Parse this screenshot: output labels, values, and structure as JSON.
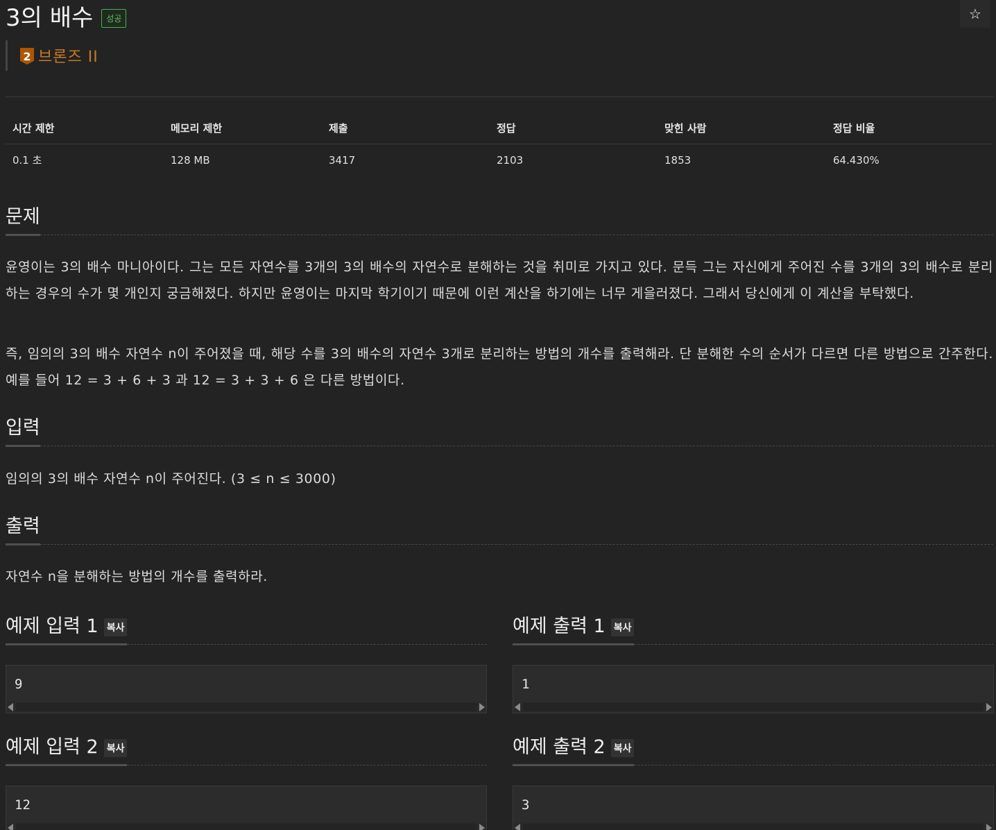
{
  "problem": {
    "title": "3의 배수",
    "result_badge": "성공",
    "star_icon": "☆",
    "tier": {
      "number": "2",
      "label": "브론즈 II",
      "color": "#ad5600"
    }
  },
  "info_table": {
    "headers": [
      "시간 제한",
      "메모리 제한",
      "제출",
      "정답",
      "맞힌 사람",
      "정답 비율"
    ],
    "values": [
      "0.1 초",
      "128 MB",
      "3417",
      "2103",
      "1853",
      "64.430%"
    ]
  },
  "sections": {
    "description": {
      "title": "문제",
      "paragraphs": [
        "윤영이는 3의 배수 마니아이다. 그는 모든 자연수를 3개의 3의 배수의 자연수로 분해하는 것을 취미로 가지고 있다. 문득 그는 자신에게 주어진 수를 3개의 3의 배수로 분리하는 경우의 수가 몇 개인지 궁금해졌다. 하지만 윤영이는 마지막 학기이기 때문에 이런 계산을 하기에는 너무 게을러졌다. 그래서 당신에게 이 계산을 부탁했다.",
        "즉, 임의의 3의 배수 자연수 n이 주어졌을 때, 해당 수를 3의 배수의 자연수 3개로 분리하는 방법의 개수를 출력해라. 단 분해한 수의 순서가 다르면 다른 방법으로 간주한다. 예를 들어 12 = 3 + 6 + 3 과 12 = 3 + 3 + 6 은 다른 방법이다."
      ]
    },
    "input": {
      "title": "입력",
      "text": "임의의 3의 배수 자연수 n이 주어진다. (3 ≤ n ≤ 3000)"
    },
    "output": {
      "title": "출력",
      "text": "자연수 n을 분해하는 방법의 개수를 출력하라."
    }
  },
  "samples": [
    {
      "input_title": "예제 입력 1",
      "output_title": "예제 출력 1",
      "copy_label": "복사",
      "input": "9",
      "output": "1"
    },
    {
      "input_title": "예제 입력 2",
      "output_title": "예제 출력 2",
      "copy_label": "복사",
      "input": "12",
      "output": "3"
    }
  ]
}
